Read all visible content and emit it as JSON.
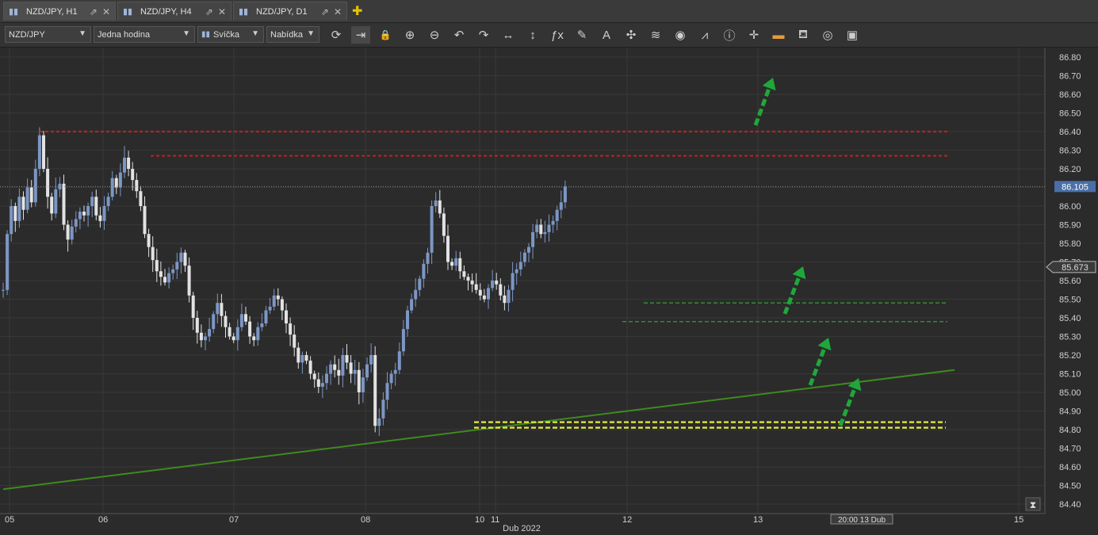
{
  "tabs": [
    {
      "label": "NZD/JPY, H1",
      "active": true
    },
    {
      "label": "NZD/JPY, H4",
      "active": false
    },
    {
      "label": "NZD/JPY, D1",
      "active": false
    }
  ],
  "toolbar": {
    "symbol": "NZD/JPY",
    "timeframe": "Jedna hodina",
    "chart_type": "Svíčka",
    "price_side": "Nabídka",
    "icons": [
      "refresh-icon",
      "autoscroll-icon",
      "lock-icon",
      "zoom-in-icon",
      "zoom-out-icon",
      "undo-icon",
      "redo-icon",
      "horizontal-scale-icon",
      "vertical-scale-icon",
      "indicator-fx-icon",
      "pencil-icon",
      "text-icon",
      "crosshair-icon",
      "layers-icon",
      "eye-icon",
      "chart-alert-icon",
      "info-icon",
      "cursor-cross-icon",
      "color-bar-icon",
      "fill-bucket-icon",
      "reset-icon",
      "save-icon"
    ]
  },
  "colors": {
    "background": "#2b2b2b",
    "grid": "#383838",
    "candle_up": "#7c97c5",
    "candle_down": "#e2e2e2",
    "resistance": "#b42323",
    "support_green": "#2f8f2f",
    "support_yellow": "#e6ee3a",
    "trendline": "#3f8a1f",
    "arrow": "#1fa83a",
    "price_label_bg": "#4a6fa8"
  },
  "chart_data": {
    "type": "candlestick",
    "symbol": "NZD/JPY",
    "timeframe": "H1",
    "ylim": [
      84.35,
      86.85
    ],
    "y_ticks": [
      "86.80",
      "86.70",
      "86.60",
      "86.50",
      "86.40",
      "86.30",
      "86.20",
      "86.10",
      "86.00",
      "85.90",
      "85.80",
      "85.70",
      "85.60",
      "85.50",
      "85.40",
      "85.30",
      "85.20",
      "85.10",
      "85.00",
      "84.90",
      "84.80",
      "84.70",
      "84.60",
      "84.50",
      "84.40"
    ],
    "x_ticks": [
      "05",
      "06",
      "07",
      "08",
      "10",
      "11",
      "12",
      "13",
      "15"
    ],
    "x_axis_label": "Dub 2022",
    "crosshair_time_label": "20:00 13 Dub",
    "current_price": "86.105",
    "secondary_price": "85.673",
    "resistance_levels": [
      86.4,
      86.27
    ],
    "support_levels": [
      85.48,
      85.38
    ],
    "key_support_levels": [
      84.84,
      84.81
    ],
    "trendline": {
      "start_bar": 0,
      "start_price": 84.48,
      "end_bar": 171,
      "end_price": 85.12
    },
    "up_arrows": 4,
    "candles_start_price": 85.55,
    "candle_path": [
      85.55,
      85.85,
      86.0,
      85.92,
      86.05,
      85.98,
      86.1,
      86.02,
      86.2,
      86.38,
      86.2,
      86.05,
      85.96,
      86.09,
      86.12,
      85.9,
      85.82,
      85.89,
      85.93,
      85.97,
      85.95,
      86.0,
      86.05,
      85.95,
      85.92,
      86.0,
      86.05,
      86.15,
      86.1,
      86.18,
      86.26,
      86.2,
      86.14,
      86.08,
      86.0,
      85.85,
      85.78,
      85.71,
      85.65,
      85.62,
      85.59,
      85.64,
      85.66,
      85.7,
      85.75,
      85.68,
      85.52,
      85.4,
      85.32,
      85.28,
      85.3,
      85.34,
      85.42,
      85.48,
      85.41,
      85.35,
      85.3,
      85.28,
      85.35,
      85.42,
      85.38,
      85.3,
      85.28,
      85.35,
      85.37,
      85.44,
      85.46,
      85.52,
      85.5,
      85.44,
      85.37,
      85.31,
      85.24,
      85.16,
      85.2,
      85.17,
      85.1,
      85.07,
      85.03,
      85.05,
      85.1,
      85.15,
      85.12,
      85.09,
      85.2,
      85.16,
      85.1,
      85.12,
      85.0,
      85.08,
      85.15,
      85.2,
      84.82,
      84.86,
      84.96,
      85.05,
      85.1,
      85.12,
      85.22,
      85.34,
      85.44,
      85.5,
      85.55,
      85.61,
      85.69,
      85.75,
      86.0,
      86.03,
      85.96,
      85.84,
      85.7,
      85.68,
      85.72,
      85.65,
      85.62,
      85.6,
      85.58,
      85.55,
      85.52,
      85.5,
      85.56,
      85.6,
      85.58,
      85.52,
      85.48,
      85.55,
      85.64,
      85.66,
      85.7,
      85.75,
      85.78,
      85.86,
      85.9,
      85.85,
      85.86,
      85.9,
      85.92,
      85.98,
      86.02,
      86.105
    ]
  }
}
